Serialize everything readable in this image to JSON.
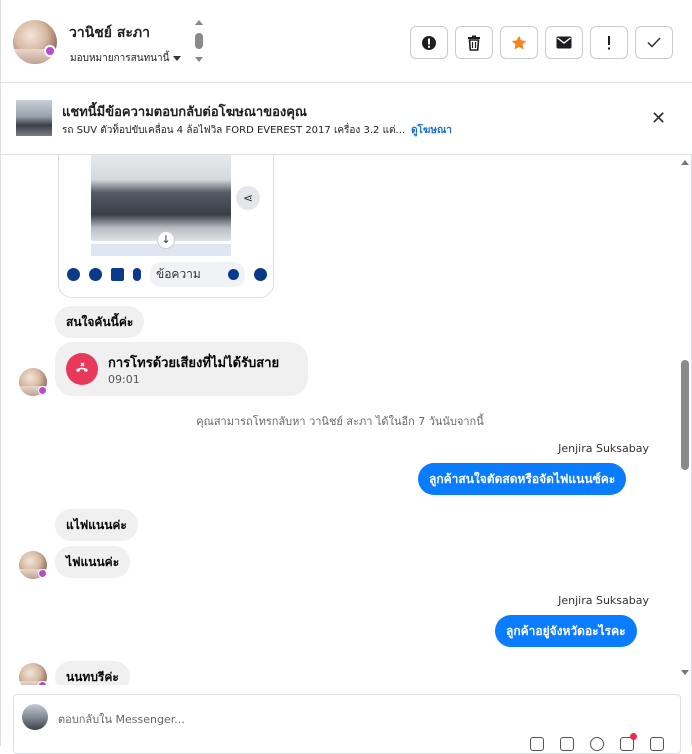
{
  "header": {
    "contact_name": "วานิชย์ สะภา",
    "assign_label": "มอบหมายการสนทนานี้",
    "actions": [
      {
        "icon": "alert-circle-icon"
      },
      {
        "icon": "trash-icon"
      },
      {
        "icon": "star-icon"
      },
      {
        "icon": "mail-icon"
      },
      {
        "icon": "exclamation-icon"
      },
      {
        "icon": "check-icon"
      }
    ]
  },
  "ad_banner": {
    "title": "แชทนี้มีข้อความตอบกลับต่อโฆษณาของคุณ",
    "subtitle": "รถ SUV ตัวท็อปขับเคลื่อน 4 ล้อไฟวิล FORD EVEREST 2017 เครื่อง 3.2 แต่...",
    "link": "ดูโฆษณา",
    "close": "✕"
  },
  "card": {
    "input_placeholder": "ข้อความ"
  },
  "messages": [
    {
      "id": "m1",
      "side": "in",
      "text": "สนใจคันนี้ค่ะ"
    },
    {
      "id": "m2",
      "type": "call",
      "title": "การโทรด้วยเสียงที่ไม่ได้รับสาย",
      "time": "09:01"
    },
    {
      "id": "m3",
      "type": "system",
      "text": "คุณสามารถโทรกลับหา วานิชย์ สะภา ได้ในอีก 7 วันนับจากนี้"
    },
    {
      "id": "m4",
      "side": "out",
      "sender": "Jenjira Suksabay",
      "text": "ลูกค้าสนใจตัดสดหรือจัดไฟแนนซ์คะ"
    },
    {
      "id": "m5",
      "side": "in",
      "text": "แไฟแนนค่ะ"
    },
    {
      "id": "m6",
      "side": "in",
      "text": "ไฟแนนค่ะ"
    },
    {
      "id": "m7",
      "side": "out",
      "sender": "Jenjira Suksabay",
      "text": "ลูกค้าอยู่จังหวัดอะไรคะ"
    },
    {
      "id": "m8",
      "side": "in",
      "text": "นนทบรีค่ะ"
    }
  ],
  "reply": {
    "placeholder": "ตอบกลับใน Messenger..."
  },
  "colors": {
    "accent_blue": "#0a7cff",
    "star_orange": "#f5821f",
    "missed_call_red": "#e8395a",
    "link_blue": "#1a6ed8"
  }
}
